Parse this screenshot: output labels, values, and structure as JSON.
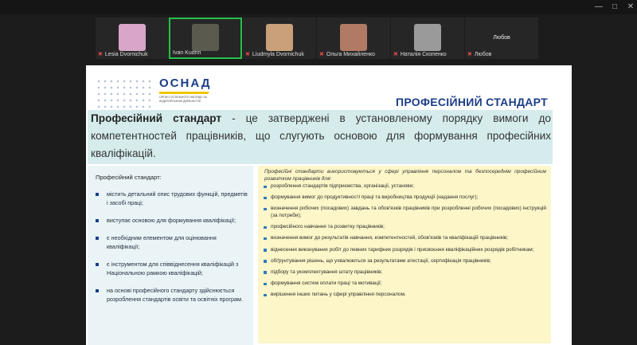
{
  "window": {
    "controls": [
      "—",
      "□",
      "✕"
    ]
  },
  "participants": [
    {
      "name": "Lesia Dvornichuk",
      "active": false,
      "thumb": "#d7a6c8"
    },
    {
      "name": "Ivan Kudrin",
      "active": true,
      "thumb": "#5a5a4e"
    },
    {
      "name": "Liudmyla Dvornichuk",
      "active": false,
      "thumb": "#c9a07a"
    },
    {
      "name": "Ольга Михайленко",
      "active": false,
      "thumb": "#b07a64"
    },
    {
      "name": "Наталія Скопенко",
      "active": false,
      "thumb": "#9a9a9a"
    },
    {
      "name": "Любов",
      "center_label": "Любов",
      "active": false
    }
  ],
  "slide": {
    "logo": "ОСНАД",
    "logo_sub": "Орган суспільного нагляду за аудиторською діяльністю",
    "title": "ПРОФЕСІЙНИЙ СТАНДАРТ",
    "definition_term": "Професійний стандарт",
    "definition_text": " - це затверджені в установленому порядку вимоги до компетентностей працівників, що слугують основою для формування професійних кваліфікацій.",
    "left_heading": "Професійний стандарт:",
    "left_items": [
      "містить детальний опис трудових функцій, предметів і засобі праці;",
      "виступає основою для формування кваліфікації;",
      "є необхідним елементом для оцінювання кваліфікації;",
      "є інструментом для співвіднесення кваліфікацій з Національною рамкою кваліфікацій;",
      "на основі професійного стандарту здійснюється розроблення стандартів освіти та освітніх програм."
    ],
    "right_intro": "Професійні стандарти використовуються у сфері управління персоналом та безпосереднім професійним розвитком працівників для:",
    "right_items": [
      "розроблення стандартів підприємства, організації, установи;",
      "формування вимог до продуктивності праці та виробництва продукції (надання послуг);",
      "визначення робочих (посадових) завдань та обов'язків працівників при розробленні робочих (посадових) інструкцій (за потреби);",
      "професійного навчання та розвитку працівників;",
      "визначення вимог до результатів навчання, компетентностей, обов'язків та кваліфікацій працівників;",
      "віднесення виконуваних робіт до певних тарифних розрядів і присвоєння кваліфікаційних розрядів робітникам;",
      "обґрунтування рішень, що ухвалюються за результатами атестації, сертифікація працівників;",
      "підбору та укомплектування штату працівників;",
      "формування систем оплати праці та мотивації;",
      "вирішення інших питань у сфері управління персоналом."
    ]
  },
  "colors": {
    "brand_blue": "#1b3e87",
    "brand_yellow": "#f2c500",
    "definition_bg": "#d6ecec",
    "left_bg": "#eaf3f6",
    "right_bg": "#fcf6c8",
    "active_border": "#27c04a"
  }
}
